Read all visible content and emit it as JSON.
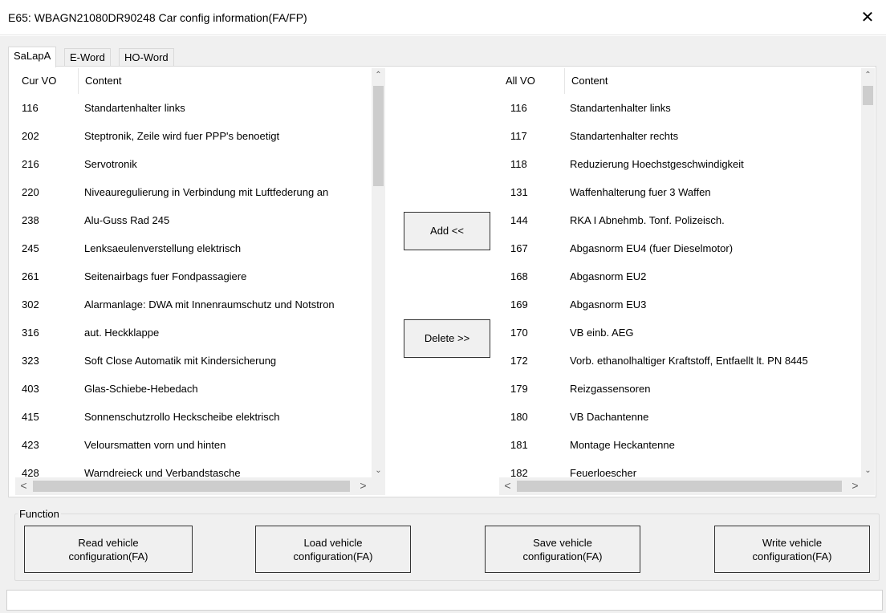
{
  "window": {
    "title": "E65: WBAGN21080DR90248 Car config information(FA/FP)",
    "close_glyph": "✕"
  },
  "tabs": [
    {
      "label": "SaLapA",
      "active": true
    },
    {
      "label": "E-Word",
      "active": false
    },
    {
      "label": "HO-Word",
      "active": false
    }
  ],
  "left_list": {
    "headers": [
      "Cur VO",
      "Content"
    ],
    "rows": [
      [
        "116",
        "Standartenhalter links"
      ],
      [
        "202",
        "Steptronik, Zeile wird fuer PPP's benoetigt"
      ],
      [
        "216",
        "Servotronik"
      ],
      [
        "220",
        "Niveauregulierung in Verbindung mit Luftfederung an"
      ],
      [
        "238",
        "Alu-Guss Rad 245"
      ],
      [
        "245",
        "Lenksaeulenverstellung elektrisch"
      ],
      [
        "261",
        "Seitenairbags fuer Fondpassagiere"
      ],
      [
        "302",
        "Alarmanlage: DWA mit Innenraumschutz und Notstron"
      ],
      [
        "316",
        "aut. Heckklappe"
      ],
      [
        "323",
        "Soft Close Automatik mit Kindersicherung"
      ],
      [
        "403",
        "Glas-Schiebe-Hebedach"
      ],
      [
        "415",
        "Sonnenschutzrollo Heckscheibe elektrisch"
      ],
      [
        "423",
        "Veloursmatten vorn und hinten"
      ],
      [
        "428",
        "Warndreieck und Verbandstasche"
      ]
    ]
  },
  "right_list": {
    "headers": [
      "All VO",
      "Content"
    ],
    "rows": [
      [
        "116",
        "Standartenhalter links"
      ],
      [
        "117",
        "Standartenhalter rechts"
      ],
      [
        "118",
        "Reduzierung Hoechstgeschwindigkeit"
      ],
      [
        "131",
        "Waffenhalterung fuer 3 Waffen"
      ],
      [
        "144",
        "RKA I Abnehmb. Tonf. Polizeisch."
      ],
      [
        "167",
        "Abgasnorm EU4 (fuer Dieselmotor)"
      ],
      [
        "168",
        "Abgasnorm EU2"
      ],
      [
        "169",
        "Abgasnorm EU3"
      ],
      [
        "170",
        "VB einb. AEG"
      ],
      [
        "172",
        "Vorb. ethanolhaltiger Kraftstoff, Entfaellt lt. PN 8445"
      ],
      [
        "179",
        "Reizgassensoren"
      ],
      [
        "180",
        "VB Dachantenne"
      ],
      [
        "181",
        "Montage Heckantenne"
      ],
      [
        "182",
        "Feuerloescher"
      ]
    ]
  },
  "middle_buttons": {
    "add": "Add <<",
    "delete": "Delete >>"
  },
  "function_group": {
    "legend": "Function",
    "buttons": [
      {
        "line1": "Read vehicle",
        "line2": "configuration(FA)"
      },
      {
        "line1": "Load vehicle",
        "line2": "configuration(FA)"
      },
      {
        "line1": "Save vehicle",
        "line2": "configuration(FA)"
      },
      {
        "line1": "Write vehicle",
        "line2": "configuration(FA)"
      }
    ]
  },
  "scroll": {
    "up": "⌃",
    "down": "⌄",
    "left": "<",
    "right": ">"
  },
  "statusbar": {
    "text": ""
  }
}
